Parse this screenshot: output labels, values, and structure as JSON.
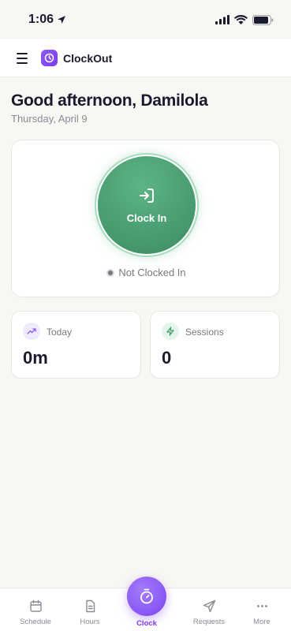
{
  "status_bar": {
    "time": "1:06"
  },
  "header": {
    "app_name": "ClockOut"
  },
  "greeting": {
    "title": "Good afternoon, Damilola",
    "date": "Thursday, April 9"
  },
  "clock": {
    "button_label": "Clock In",
    "status": "Not Clocked In"
  },
  "stats": [
    {
      "label": "Today",
      "value": "0m",
      "icon": "trending-up-icon"
    },
    {
      "label": "Sessions",
      "value": "0",
      "icon": "lightning-icon"
    }
  ],
  "nav": {
    "items": [
      {
        "label": "Schedule",
        "icon": "calendar-icon"
      },
      {
        "label": "Hours",
        "icon": "document-icon"
      },
      {
        "label": "Clock",
        "icon": "stopwatch-icon"
      },
      {
        "label": "Requests",
        "icon": "send-icon"
      },
      {
        "label": "More",
        "icon": "more-dots-icon"
      }
    ],
    "active": "Clock"
  },
  "colors": {
    "accent_purple": "#8b5cf6",
    "clock_green": "#4a9e72",
    "background": "#f8f7f4"
  }
}
